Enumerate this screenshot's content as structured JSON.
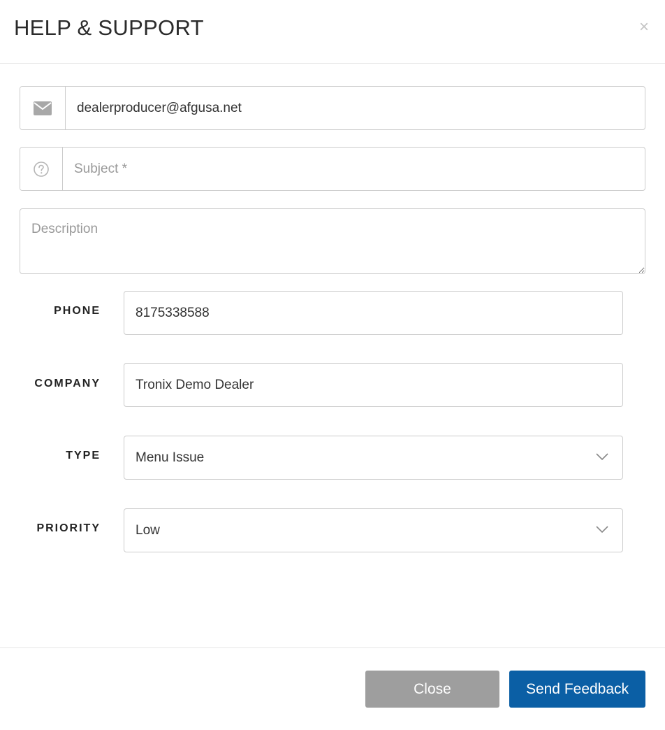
{
  "modal": {
    "title": "HELP & SUPPORT",
    "close_glyph": "×"
  },
  "form": {
    "email": {
      "value": "dealerproducer@afgusa.net",
      "icon": "envelope-icon"
    },
    "subject": {
      "value": "",
      "placeholder": "Subject *",
      "icon": "question-circle-icon"
    },
    "description": {
      "value": "",
      "placeholder": "Description"
    },
    "phone": {
      "label": "PHONE",
      "value": "8175338588"
    },
    "company": {
      "label": "COMPANY",
      "value": "Tronix Demo Dealer"
    },
    "type": {
      "label": "TYPE",
      "selected": "Menu Issue"
    },
    "priority": {
      "label": "PRIORITY",
      "selected": "Low"
    }
  },
  "footer": {
    "close_label": "Close",
    "send_label": "Send Feedback"
  },
  "colors": {
    "primary_button": "#0b5fa5",
    "secondary_button": "#9e9e9e",
    "border": "#cccccc"
  }
}
